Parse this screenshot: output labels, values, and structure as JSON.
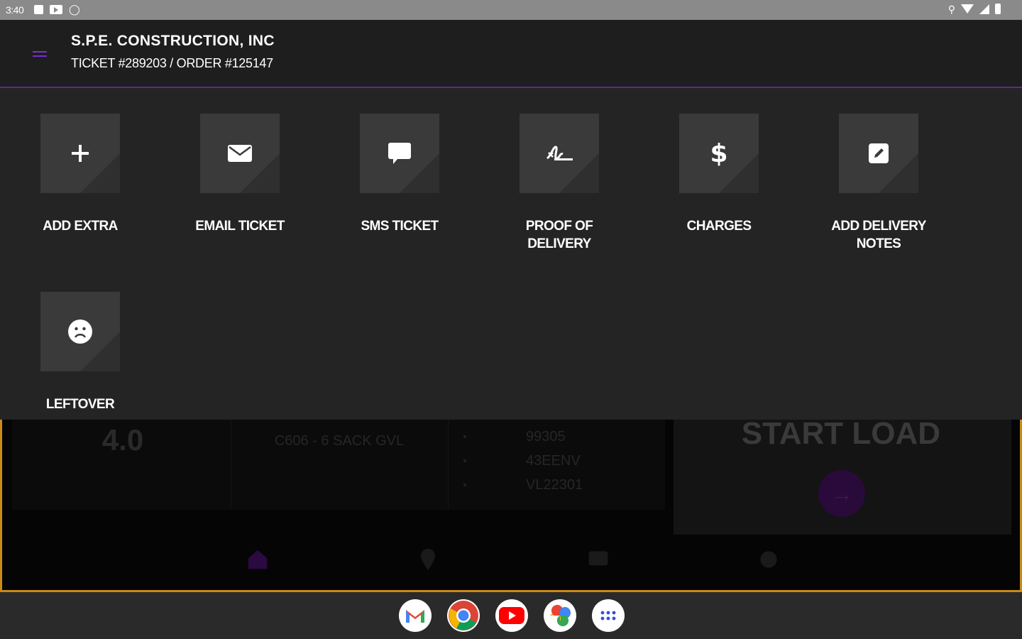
{
  "status_bar": {
    "time": "3:40"
  },
  "header": {
    "company": "S.P.E. CONSTRUCTION, INC",
    "ticket_line": "TICKET #289203 / ORDER #125147"
  },
  "actions": [
    {
      "label": "ADD EXTRA",
      "icon": "plus-icon"
    },
    {
      "label": "EMAIL TICKET",
      "icon": "envelope-icon"
    },
    {
      "label": "SMS TICKET",
      "icon": "chat-bubble-icon"
    },
    {
      "label_line1": "PROOF OF",
      "label_line2": "DELIVERY",
      "icon": "signature-icon"
    },
    {
      "label": "CHARGES",
      "icon": "dollar-icon"
    },
    {
      "label_line1": "ADD DELIVERY",
      "label_line2": "NOTES",
      "icon": "edit-note-icon"
    },
    {
      "label": "LEFTOVER",
      "icon": "sad-face-icon"
    }
  ],
  "background_screen": {
    "quantity": "4.0",
    "product": "C606 - 6 SACK GVL",
    "codes": [
      "99305",
      "43EENV",
      "VL22301"
    ],
    "start_load": "START LOAD"
  },
  "colors": {
    "accent": "#7a2ed6",
    "frame": "#c98a16",
    "sheet": "#242424",
    "tile": "#3a3a3a"
  },
  "dock_apps": [
    "gmail-icon",
    "chrome-icon",
    "youtube-icon",
    "photos-icon",
    "app-drawer-icon"
  ]
}
